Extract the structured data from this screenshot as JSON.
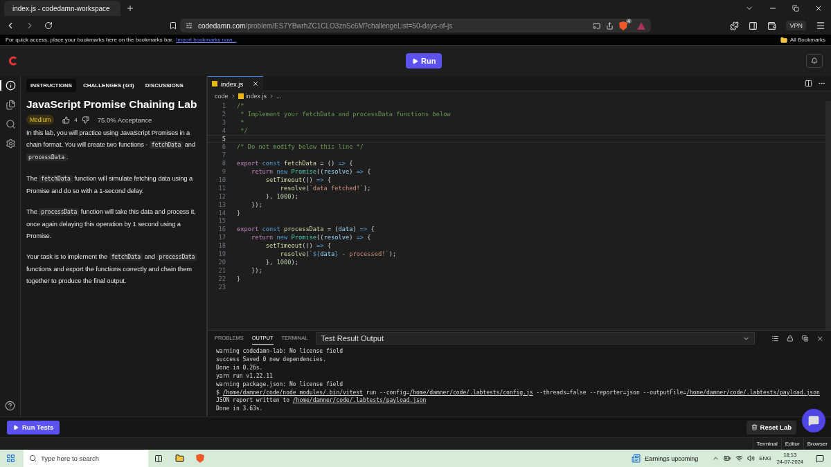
{
  "browser": {
    "tab": {
      "title": "index.js - codedamn-workspace"
    },
    "url": {
      "host": "codedamn.com",
      "path": "/problem/ES7YBwrhZC1CLO3znSc6M?challengeList=50-days-of-js"
    },
    "shield_count": "4",
    "vpn": "VPN",
    "bookmarks_bar": {
      "text": "For quick access, place your bookmarks here on the bookmarks bar.",
      "link": "Import bookmarks now...",
      "all": "All Bookmarks"
    }
  },
  "header": {
    "run": "Run"
  },
  "sidebar": {
    "items": [
      {
        "kind": "info",
        "selected": true
      },
      {
        "kind": "files",
        "selected": false
      },
      {
        "kind": "search",
        "selected": false
      },
      {
        "kind": "settings",
        "selected": false
      }
    ]
  },
  "panel_tabs": [
    {
      "label": "INSTRUCTIONS",
      "selected": true
    },
    {
      "label": "CHALLENGES (4/4)",
      "selected": false
    },
    {
      "label": "DISCUSSIONS",
      "selected": false
    }
  ],
  "problem": {
    "title": "JavaScript Promise Chaining Lab",
    "difficulty": "Medium",
    "likes": "4",
    "acceptance": "75.0% Acceptance",
    "paragraphs": [
      [
        {
          "text": "In this lab, you will practice using JavaScript Promises in a chain format. You will create two functions - ",
          "code": false
        },
        {
          "text": "fetchData",
          "code": true
        },
        {
          "text": " and ",
          "code": false
        },
        {
          "text": "processData",
          "code": true
        },
        {
          "text": ".",
          "code": false
        }
      ],
      [
        {
          "text": "The ",
          "code": false
        },
        {
          "text": "fetchData",
          "code": true
        },
        {
          "text": " function will simulate fetching data using a Promise and do so with a 1-second delay.",
          "code": false
        }
      ],
      [
        {
          "text": "The ",
          "code": false
        },
        {
          "text": "processData",
          "code": true
        },
        {
          "text": " function will take this data and process it, once again delaying this operation by 1 second using a Promise.",
          "code": false
        }
      ],
      [
        {
          "text": "Your task is to implement the ",
          "code": false
        },
        {
          "text": "fetchData",
          "code": true
        },
        {
          "text": " and ",
          "code": false
        },
        {
          "text": "processData",
          "code": true
        },
        {
          "text": " functions and export the functions correctly and chain them together to produce the final output.",
          "code": false
        }
      ]
    ]
  },
  "editor": {
    "tab": "index.js",
    "breadcrumb": [
      "code",
      "index.js",
      "..."
    ],
    "lines": [
      {
        "num": "1",
        "current": false,
        "tokens": [
          {
            "text": "/*",
            "kind": "comment"
          }
        ]
      },
      {
        "num": "2",
        "current": false,
        "tokens": [
          {
            "text": " * Implement your fetchData and processData functions below",
            "kind": "comment"
          }
        ]
      },
      {
        "num": "3",
        "current": false,
        "tokens": [
          {
            "text": " *",
            "kind": "comment"
          }
        ]
      },
      {
        "num": "4",
        "current": false,
        "tokens": [
          {
            "text": " */",
            "kind": "comment"
          }
        ]
      },
      {
        "num": "5",
        "current": true
      },
      {
        "num": "6",
        "current": false,
        "tokens": [
          {
            "text": "/* Do not modify below this line */",
            "kind": "comment"
          }
        ]
      },
      {
        "num": "7",
        "current": false
      },
      {
        "num": "8",
        "current": false,
        "tokens": [
          {
            "text": "export",
            "kind": "keyword"
          },
          {
            "text": " const",
            "kind": "storage"
          },
          {
            "text": " fetchData",
            "kind": "func"
          },
          {
            "text": " = () ",
            "kind": "plain"
          },
          {
            "text": "=>",
            "kind": "storage"
          },
          {
            "text": " {",
            "kind": "plain"
          }
        ]
      },
      {
        "num": "9",
        "current": false,
        "tokens": [
          {
            "text": "    return",
            "kind": "keyword"
          },
          {
            "text": " new",
            "kind": "storage"
          },
          {
            "text": " Promise",
            "kind": "type"
          },
          {
            "text": "((",
            "kind": "plain"
          },
          {
            "text": "resolve",
            "kind": "param"
          },
          {
            "text": ") ",
            "kind": "plain"
          },
          {
            "text": "=>",
            "kind": "storage"
          },
          {
            "text": " {",
            "kind": "plain"
          }
        ]
      },
      {
        "num": "10",
        "current": false,
        "tokens": [
          {
            "text": "        setTimeout",
            "kind": "func"
          },
          {
            "text": "(() ",
            "kind": "plain"
          },
          {
            "text": "=>",
            "kind": "storage"
          },
          {
            "text": " {",
            "kind": "plain"
          }
        ]
      },
      {
        "num": "11",
        "current": false,
        "tokens": [
          {
            "text": "            resolve",
            "kind": "func"
          },
          {
            "text": "(",
            "kind": "plain"
          },
          {
            "text": "`data fetched!`",
            "kind": "string"
          },
          {
            "text": ");",
            "kind": "plain"
          }
        ]
      },
      {
        "num": "12",
        "current": false,
        "tokens": [
          {
            "text": "        }, ",
            "kind": "plain"
          },
          {
            "text": "1000",
            "kind": "number"
          },
          {
            "text": ");",
            "kind": "plain"
          }
        ]
      },
      {
        "num": "13",
        "current": false,
        "tokens": [
          {
            "text": "    });",
            "kind": "plain"
          }
        ]
      },
      {
        "num": "14",
        "current": false,
        "tokens": [
          {
            "text": "}",
            "kind": "plain"
          }
        ]
      },
      {
        "num": "15",
        "current": false
      },
      {
        "num": "16",
        "current": false,
        "tokens": [
          {
            "text": "export",
            "kind": "keyword"
          },
          {
            "text": " const",
            "kind": "storage"
          },
          {
            "text": " processData",
            "kind": "func"
          },
          {
            "text": " = (",
            "kind": "plain"
          },
          {
            "text": "data",
            "kind": "param"
          },
          {
            "text": ") ",
            "kind": "plain"
          },
          {
            "text": "=>",
            "kind": "storage"
          },
          {
            "text": " {",
            "kind": "plain"
          }
        ]
      },
      {
        "num": "17",
        "current": false,
        "tokens": [
          {
            "text": "    return",
            "kind": "keyword"
          },
          {
            "text": " new",
            "kind": "storage"
          },
          {
            "text": " Promise",
            "kind": "type"
          },
          {
            "text": "((",
            "kind": "plain"
          },
          {
            "text": "resolve",
            "kind": "param"
          },
          {
            "text": ") ",
            "kind": "plain"
          },
          {
            "text": "=>",
            "kind": "storage"
          },
          {
            "text": " {",
            "kind": "plain"
          }
        ]
      },
      {
        "num": "18",
        "current": false,
        "tokens": [
          {
            "text": "        setTimeout",
            "kind": "func"
          },
          {
            "text": "(() ",
            "kind": "plain"
          },
          {
            "text": "=>",
            "kind": "storage"
          },
          {
            "text": " {",
            "kind": "plain"
          }
        ]
      },
      {
        "num": "19",
        "current": false,
        "tokens": [
          {
            "text": "            resolve",
            "kind": "func"
          },
          {
            "text": "(",
            "kind": "plain"
          },
          {
            "text": "`",
            "kind": "string"
          },
          {
            "text": "${",
            "kind": "storage"
          },
          {
            "text": "data",
            "kind": "param"
          },
          {
            "text": "}",
            "kind": "storage"
          },
          {
            "text": " - processed!`",
            "kind": "string"
          },
          {
            "text": ");",
            "kind": "plain"
          }
        ]
      },
      {
        "num": "20",
        "current": false,
        "tokens": [
          {
            "text": "        }, ",
            "kind": "plain"
          },
          {
            "text": "1000",
            "kind": "number"
          },
          {
            "text": ");",
            "kind": "plain"
          }
        ]
      },
      {
        "num": "21",
        "current": false,
        "tokens": [
          {
            "text": "    });",
            "kind": "plain"
          }
        ]
      },
      {
        "num": "22",
        "current": false,
        "tokens": [
          {
            "text": "}",
            "kind": "plain"
          }
        ]
      },
      {
        "num": "23",
        "current": false
      }
    ]
  },
  "output": {
    "tabs": [
      {
        "label": "PROBLEMS",
        "selected": false
      },
      {
        "label": "OUTPUT",
        "selected": true
      },
      {
        "label": "TERMINAL",
        "selected": false
      }
    ],
    "channel": "Test Result Output",
    "lines": [
      [
        {
          "text": "warning codedamn-lab: No license field",
          "link": false
        }
      ],
      [
        {
          "text": "success Saved 0 new dependencies.",
          "link": false
        }
      ],
      [
        {
          "text": "Done in 0.26s.",
          "link": false
        }
      ],
      [
        {
          "text": "yarn run v1.22.11",
          "link": false
        }
      ],
      [
        {
          "text": "warning package.json: No license field",
          "link": false
        }
      ],
      [
        {
          "text": "$ ",
          "link": false
        },
        {
          "text": "/home/damner/code/node_modules/.bin/vitest",
          "link": true
        },
        {
          "text": " run --config=",
          "link": false
        },
        {
          "text": "/home/damner/code/.labtests/config.js",
          "link": true
        },
        {
          "text": " --threads=false --reporter=json --outputFile=",
          "link": false
        },
        {
          "text": "/home/damner/code/.labtests/payload.json",
          "link": true
        }
      ],
      [
        {
          "text": "JSON report written to ",
          "link": false
        },
        {
          "text": "/home/damner/code/.labtests/payload.json",
          "link": true
        }
      ],
      [
        {
          "text": "Done in 3.63s.",
          "link": false
        }
      ]
    ]
  },
  "footer": {
    "run_tests": "Run Tests",
    "reset": "Reset Lab"
  },
  "view_switch": [
    {
      "label": "Terminal",
      "selected": false
    },
    {
      "label": "Editor",
      "selected": false
    },
    {
      "label": "Browser",
      "selected": false
    }
  ],
  "taskbar": {
    "search_placeholder": "Type here to search",
    "news": "Earnings upcoming",
    "lang": "ENG",
    "time": "18:13",
    "date": "24-07-2024"
  }
}
